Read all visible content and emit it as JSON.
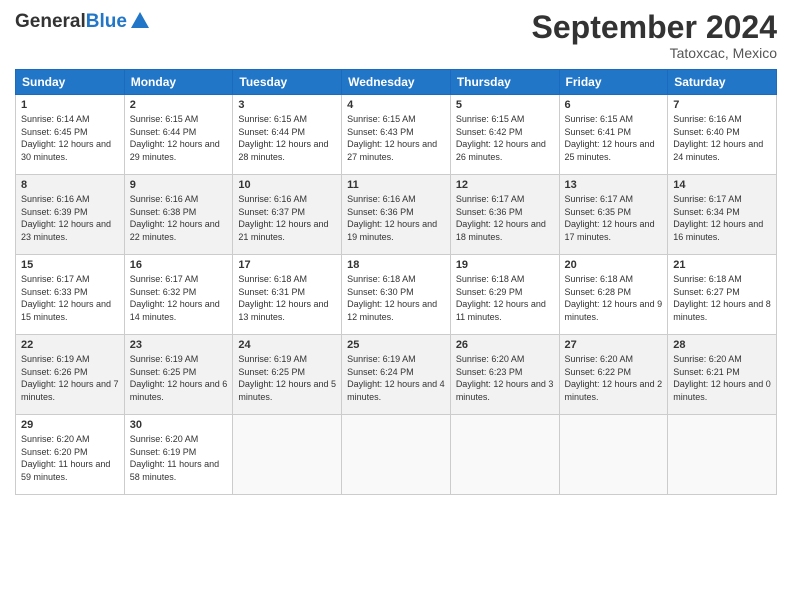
{
  "header": {
    "logo_general": "General",
    "logo_blue": "Blue",
    "month_title": "September 2024",
    "location": "Tatoxcac, Mexico"
  },
  "weekdays": [
    "Sunday",
    "Monday",
    "Tuesday",
    "Wednesday",
    "Thursday",
    "Friday",
    "Saturday"
  ],
  "weeks": [
    [
      {
        "day": "1",
        "sunrise": "Sunrise: 6:14 AM",
        "sunset": "Sunset: 6:45 PM",
        "daylight": "Daylight: 12 hours and 30 minutes."
      },
      {
        "day": "2",
        "sunrise": "Sunrise: 6:15 AM",
        "sunset": "Sunset: 6:44 PM",
        "daylight": "Daylight: 12 hours and 29 minutes."
      },
      {
        "day": "3",
        "sunrise": "Sunrise: 6:15 AM",
        "sunset": "Sunset: 6:44 PM",
        "daylight": "Daylight: 12 hours and 28 minutes."
      },
      {
        "day": "4",
        "sunrise": "Sunrise: 6:15 AM",
        "sunset": "Sunset: 6:43 PM",
        "daylight": "Daylight: 12 hours and 27 minutes."
      },
      {
        "day": "5",
        "sunrise": "Sunrise: 6:15 AM",
        "sunset": "Sunset: 6:42 PM",
        "daylight": "Daylight: 12 hours and 26 minutes."
      },
      {
        "day": "6",
        "sunrise": "Sunrise: 6:15 AM",
        "sunset": "Sunset: 6:41 PM",
        "daylight": "Daylight: 12 hours and 25 minutes."
      },
      {
        "day": "7",
        "sunrise": "Sunrise: 6:16 AM",
        "sunset": "Sunset: 6:40 PM",
        "daylight": "Daylight: 12 hours and 24 minutes."
      }
    ],
    [
      {
        "day": "8",
        "sunrise": "Sunrise: 6:16 AM",
        "sunset": "Sunset: 6:39 PM",
        "daylight": "Daylight: 12 hours and 23 minutes."
      },
      {
        "day": "9",
        "sunrise": "Sunrise: 6:16 AM",
        "sunset": "Sunset: 6:38 PM",
        "daylight": "Daylight: 12 hours and 22 minutes."
      },
      {
        "day": "10",
        "sunrise": "Sunrise: 6:16 AM",
        "sunset": "Sunset: 6:37 PM",
        "daylight": "Daylight: 12 hours and 21 minutes."
      },
      {
        "day": "11",
        "sunrise": "Sunrise: 6:16 AM",
        "sunset": "Sunset: 6:36 PM",
        "daylight": "Daylight: 12 hours and 19 minutes."
      },
      {
        "day": "12",
        "sunrise": "Sunrise: 6:17 AM",
        "sunset": "Sunset: 6:36 PM",
        "daylight": "Daylight: 12 hours and 18 minutes."
      },
      {
        "day": "13",
        "sunrise": "Sunrise: 6:17 AM",
        "sunset": "Sunset: 6:35 PM",
        "daylight": "Daylight: 12 hours and 17 minutes."
      },
      {
        "day": "14",
        "sunrise": "Sunrise: 6:17 AM",
        "sunset": "Sunset: 6:34 PM",
        "daylight": "Daylight: 12 hours and 16 minutes."
      }
    ],
    [
      {
        "day": "15",
        "sunrise": "Sunrise: 6:17 AM",
        "sunset": "Sunset: 6:33 PM",
        "daylight": "Daylight: 12 hours and 15 minutes."
      },
      {
        "day": "16",
        "sunrise": "Sunrise: 6:17 AM",
        "sunset": "Sunset: 6:32 PM",
        "daylight": "Daylight: 12 hours and 14 minutes."
      },
      {
        "day": "17",
        "sunrise": "Sunrise: 6:18 AM",
        "sunset": "Sunset: 6:31 PM",
        "daylight": "Daylight: 12 hours and 13 minutes."
      },
      {
        "day": "18",
        "sunrise": "Sunrise: 6:18 AM",
        "sunset": "Sunset: 6:30 PM",
        "daylight": "Daylight: 12 hours and 12 minutes."
      },
      {
        "day": "19",
        "sunrise": "Sunrise: 6:18 AM",
        "sunset": "Sunset: 6:29 PM",
        "daylight": "Daylight: 12 hours and 11 minutes."
      },
      {
        "day": "20",
        "sunrise": "Sunrise: 6:18 AM",
        "sunset": "Sunset: 6:28 PM",
        "daylight": "Daylight: 12 hours and 9 minutes."
      },
      {
        "day": "21",
        "sunrise": "Sunrise: 6:18 AM",
        "sunset": "Sunset: 6:27 PM",
        "daylight": "Daylight: 12 hours and 8 minutes."
      }
    ],
    [
      {
        "day": "22",
        "sunrise": "Sunrise: 6:19 AM",
        "sunset": "Sunset: 6:26 PM",
        "daylight": "Daylight: 12 hours and 7 minutes."
      },
      {
        "day": "23",
        "sunrise": "Sunrise: 6:19 AM",
        "sunset": "Sunset: 6:25 PM",
        "daylight": "Daylight: 12 hours and 6 minutes."
      },
      {
        "day": "24",
        "sunrise": "Sunrise: 6:19 AM",
        "sunset": "Sunset: 6:25 PM",
        "daylight": "Daylight: 12 hours and 5 minutes."
      },
      {
        "day": "25",
        "sunrise": "Sunrise: 6:19 AM",
        "sunset": "Sunset: 6:24 PM",
        "daylight": "Daylight: 12 hours and 4 minutes."
      },
      {
        "day": "26",
        "sunrise": "Sunrise: 6:20 AM",
        "sunset": "Sunset: 6:23 PM",
        "daylight": "Daylight: 12 hours and 3 minutes."
      },
      {
        "day": "27",
        "sunrise": "Sunrise: 6:20 AM",
        "sunset": "Sunset: 6:22 PM",
        "daylight": "Daylight: 12 hours and 2 minutes."
      },
      {
        "day": "28",
        "sunrise": "Sunrise: 6:20 AM",
        "sunset": "Sunset: 6:21 PM",
        "daylight": "Daylight: 12 hours and 0 minutes."
      }
    ],
    [
      {
        "day": "29",
        "sunrise": "Sunrise: 6:20 AM",
        "sunset": "Sunset: 6:20 PM",
        "daylight": "Daylight: 11 hours and 59 minutes."
      },
      {
        "day": "30",
        "sunrise": "Sunrise: 6:20 AM",
        "sunset": "Sunset: 6:19 PM",
        "daylight": "Daylight: 11 hours and 58 minutes."
      },
      null,
      null,
      null,
      null,
      null
    ]
  ],
  "row_bg": [
    "#ffffff",
    "#f2f2f2",
    "#ffffff",
    "#f2f2f2",
    "#ffffff"
  ]
}
